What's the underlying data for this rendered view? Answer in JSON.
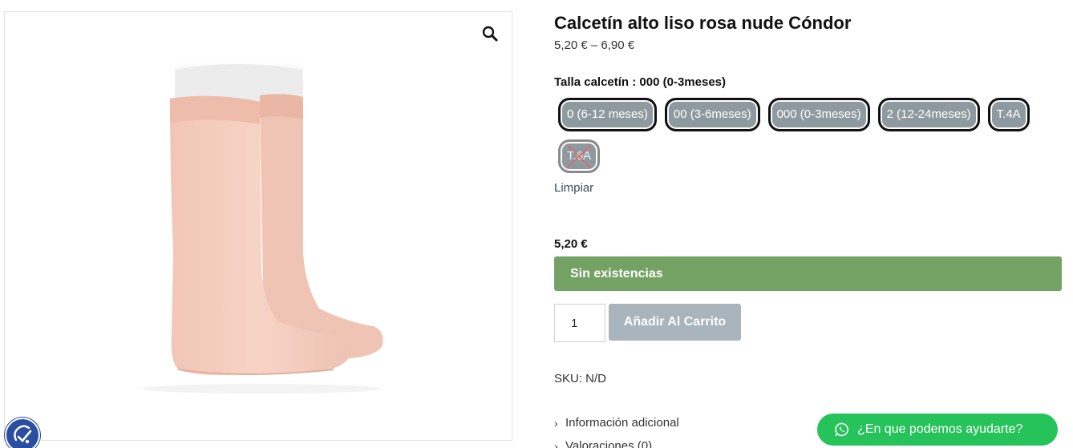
{
  "product": {
    "title": "Calcetín alto liso rosa nude Cóndor",
    "price_range": "5,20 € – 6,90 €",
    "image_icon": "knee-high-socks-image"
  },
  "attribute": {
    "label": "Talla calcetín : 000 (0-3meses)",
    "options": [
      {
        "label": "0 (6-12 meses)",
        "available": true
      },
      {
        "label": "00 (3-6meses)",
        "available": true
      },
      {
        "label": "000 (0-3meses)",
        "available": true
      },
      {
        "label": "2 (12-24meses)",
        "available": true
      },
      {
        "label": "T.4A",
        "available": true
      },
      {
        "label": "T.6A",
        "available": false
      }
    ],
    "clear_label": "Limpiar"
  },
  "variation": {
    "price": "5,20 €",
    "stock_status": "Sin existencias"
  },
  "cart": {
    "quantity": "1",
    "add_label": "Añadir Al Carrito"
  },
  "meta": {
    "sku": "SKU: N/D"
  },
  "tabs": [
    {
      "label": "Información adicional"
    },
    {
      "label": "Valoraciones (0)"
    }
  ],
  "chat": {
    "label": "¿En que podemos ayudarte?"
  },
  "colors": {
    "stock_bar": "#74a265",
    "add_button": "#a9b4bd",
    "swatch": "#8f9aa0",
    "whatsapp": "#25c35a",
    "accessibility": "#2a4fa0",
    "sock": "#f4cdbf"
  }
}
